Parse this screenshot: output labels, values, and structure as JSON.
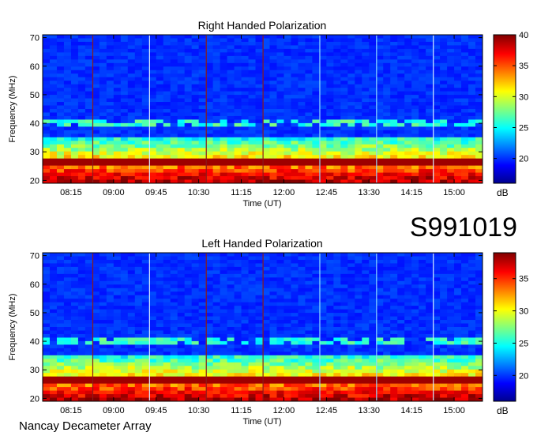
{
  "station": "Nancay Decameter Array",
  "date_code": "S991019",
  "chart_data": [
    {
      "type": "heatmap",
      "title": "Right Handed Polarization",
      "xlabel": "Time (UT)",
      "ylabel": "Frequency (MHz)",
      "x_ticks": [
        "08:15",
        "09:00",
        "09:45",
        "10:30",
        "11:15",
        "12:00",
        "12:45",
        "13:30",
        "14:15",
        "15:00"
      ],
      "y_ticks": [
        20,
        30,
        40,
        50,
        60,
        70
      ],
      "ylim": [
        19,
        71
      ],
      "colorbar": {
        "label": "dB",
        "range": [
          16,
          40
        ],
        "ticks": [
          20,
          25,
          30,
          35,
          40
        ]
      },
      "vertical_lines": [
        {
          "time": "08:38",
          "color": "#8b1a1a"
        },
        {
          "time": "09:38",
          "color": "#d8ecff"
        },
        {
          "time": "10:38",
          "color": "#8b1a1a"
        },
        {
          "time": "11:38",
          "color": "#8b1a1a"
        },
        {
          "time": "12:38",
          "color": "#8fd8ff"
        },
        {
          "time": "13:38",
          "color": "#8fd8ff"
        },
        {
          "time": "14:38",
          "color": "#d8ecff"
        }
      ]
    },
    {
      "type": "heatmap",
      "title": "Left Handed Polarization",
      "xlabel": "Time (UT)",
      "ylabel": "Frequency (MHz)",
      "x_ticks": [
        "08:15",
        "09:00",
        "09:45",
        "10:30",
        "11:15",
        "12:00",
        "12:45",
        "13:30",
        "14:15",
        "15:00"
      ],
      "y_ticks": [
        20,
        30,
        40,
        50,
        60,
        70
      ],
      "ylim": [
        19,
        71
      ],
      "colorbar": {
        "label": "dB",
        "range": [
          16,
          39
        ],
        "ticks": [
          20,
          25,
          30,
          35
        ]
      },
      "vertical_lines": [
        {
          "time": "08:38",
          "color": "#8b1a1a"
        },
        {
          "time": "09:38",
          "color": "#d8ecff"
        },
        {
          "time": "10:38",
          "color": "#8b1a1a"
        },
        {
          "time": "11:38",
          "color": "#8b1a1a"
        },
        {
          "time": "12:38",
          "color": "#8fd8ff"
        },
        {
          "time": "13:38",
          "color": "#8fd8ff"
        },
        {
          "time": "14:38",
          "color": "#d8ecff"
        }
      ]
    }
  ]
}
